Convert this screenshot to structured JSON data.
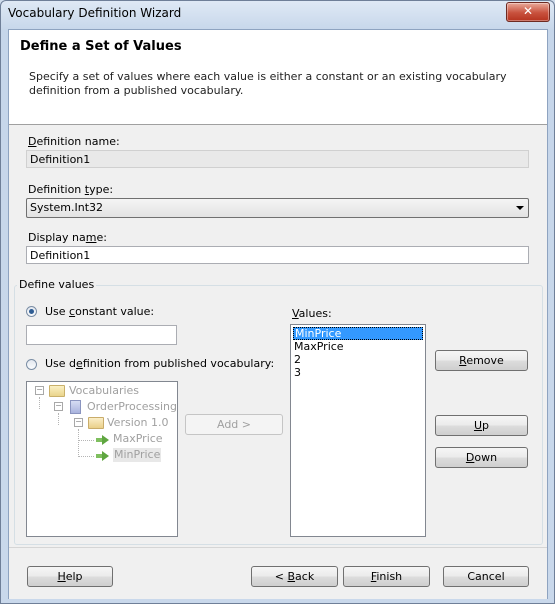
{
  "window": {
    "title": "Vocabulary Definition Wizard",
    "close_glyph": "✕"
  },
  "header": {
    "title": "Define a Set of  Values",
    "description": "Specify a set of values where each value is either a constant or an existing vocabulary definition from a published vocabulary."
  },
  "fields": {
    "definition_name": {
      "label_underline": "D",
      "label_rest": "efinition name:",
      "value": "Definition1"
    },
    "definition_type": {
      "label_pre": "Definition ",
      "label_underline": "t",
      "label_post": "ype:",
      "value": "System.Int32"
    },
    "display_name": {
      "label_pre": "Display na",
      "label_underline": "m",
      "label_post": "e:",
      "value": "Definition1"
    }
  },
  "define_values": {
    "group_label": "Define values",
    "use_constant": {
      "label_pre": "Use ",
      "label_underline": "c",
      "label_post": "onstant value:",
      "value": "",
      "selected": true
    },
    "use_definition": {
      "label_pre": "Use d",
      "label_underline": "e",
      "label_post": "finition from published vocabulary:",
      "selected": false
    },
    "tree": {
      "root": "Vocabularies",
      "vocabulary": "OrderProcessing",
      "version": "Version 1.0",
      "definitions": [
        "MaxPrice",
        "MinPrice"
      ]
    },
    "add_button": "Add >",
    "values_label_underline": "V",
    "values_label_rest": "alues:",
    "values": [
      "MinPrice",
      "MaxPrice",
      "2",
      "3"
    ],
    "remove_button_underline": "R",
    "remove_button_rest": "emove",
    "up_button_underline": "U",
    "up_button_rest": "p",
    "down_button_underline": "D",
    "down_button_rest": "own"
  },
  "footer": {
    "help_underline": "H",
    "help_rest": "elp",
    "back_pre": "< ",
    "back_underline": "B",
    "back_rest": "ack",
    "finish_underline": "F",
    "finish_rest": "inish",
    "cancel": "Cancel"
  }
}
